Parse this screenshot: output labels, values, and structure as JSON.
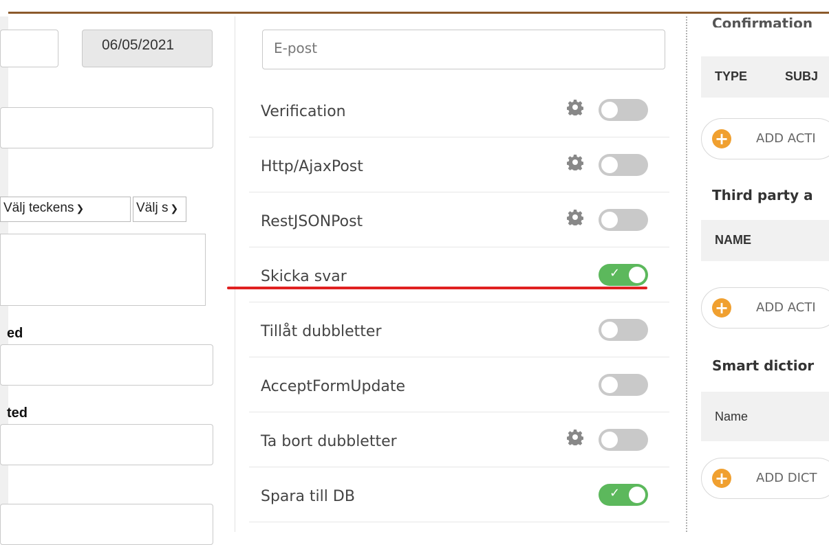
{
  "left": {
    "date_value": "06/05/2021",
    "select1": "Välj teckens",
    "select2": "Välj s",
    "label_ed": "ed",
    "label_ted": "ted"
  },
  "middle": {
    "email_placeholder": "E-post",
    "rows": [
      {
        "label": "Verification",
        "gear": true,
        "on": false
      },
      {
        "label": "Http/AjaxPost",
        "gear": true,
        "on": false
      },
      {
        "label": "RestJSONPost",
        "gear": true,
        "on": false
      },
      {
        "label": "Skicka svar",
        "gear": false,
        "on": true
      },
      {
        "label": "Tillåt dubbletter",
        "gear": false,
        "on": false
      },
      {
        "label": "AcceptFormUpdate",
        "gear": false,
        "on": false
      },
      {
        "label": "Ta bort dubbletter",
        "gear": true,
        "on": false
      },
      {
        "label": "Spara till DB",
        "gear": false,
        "on": true
      }
    ]
  },
  "right": {
    "top_cut": "Confirmation",
    "col_type": "TYPE",
    "col_subj": "SUBJ",
    "add_action_1": "ADD ACTI",
    "third_party": "Third party a",
    "col_name_caps": "NAME",
    "add_action_2": "ADD ACTI",
    "smart_dict": "Smart dictior",
    "col_name": "Name",
    "add_dict": "ADD DICT"
  },
  "colors": {
    "accent_brown": "#8b5a2b",
    "toggle_on": "#5cb85c",
    "toggle_off": "#c9c9c9",
    "add_icon": "#f0a030",
    "highlight_red": "#e02020"
  }
}
